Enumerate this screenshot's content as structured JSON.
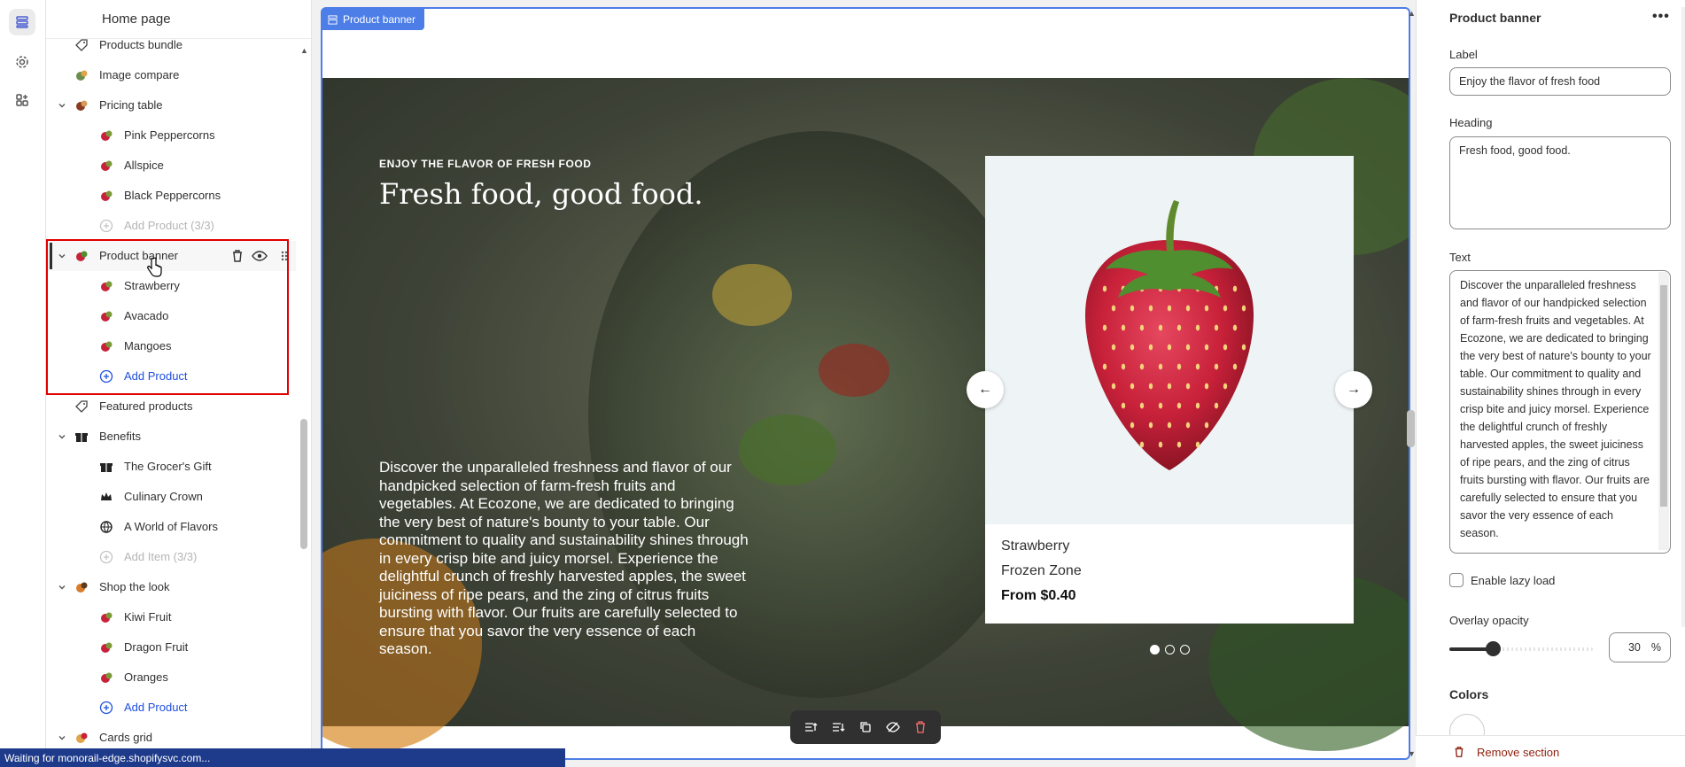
{
  "sidebar": {
    "title": "Home page",
    "rows": [
      {
        "label": "Products bundle",
        "level": 1,
        "icon": "tag-icon",
        "state": ""
      },
      {
        "label": "Image compare",
        "level": 1,
        "icon": "image-compare-icon",
        "state": ""
      },
      {
        "label": "Pricing table",
        "level": 1,
        "icon": "pricing-table-icon",
        "state": "expanded"
      },
      {
        "label": "Pink Peppercorns",
        "level": 2,
        "icon": "product-thumb-icon",
        "state": ""
      },
      {
        "label": "Allspice",
        "level": 2,
        "icon": "product-thumb-icon",
        "state": ""
      },
      {
        "label": "Black Peppercorns",
        "level": 2,
        "icon": "product-thumb-icon",
        "state": ""
      },
      {
        "label": "Add Product (3/3)",
        "level": 2,
        "icon": "add-circle-icon",
        "state": "muted"
      },
      {
        "label": "Product banner",
        "level": 1,
        "icon": "product-banner-icon",
        "state": "selected"
      },
      {
        "label": "Strawberry",
        "level": 2,
        "icon": "product-thumb-icon",
        "state": ""
      },
      {
        "label": "Avacado",
        "level": 2,
        "icon": "product-thumb-icon",
        "state": ""
      },
      {
        "label": "Mangoes",
        "level": 2,
        "icon": "product-thumb-icon",
        "state": ""
      },
      {
        "label": "Add Product",
        "level": 2,
        "icon": "add-circle-icon",
        "state": "add"
      },
      {
        "label": "Featured products",
        "level": 1,
        "icon": "tag-icon",
        "state": ""
      },
      {
        "label": "Benefits",
        "level": 1,
        "icon": "gift-icon",
        "state": "expanded"
      },
      {
        "label": "The Grocer's Gift",
        "level": 2,
        "icon": "gift-icon",
        "state": ""
      },
      {
        "label": "Culinary Crown",
        "level": 2,
        "icon": "crown-icon",
        "state": ""
      },
      {
        "label": "A World of Flavors",
        "level": 2,
        "icon": "globe-icon",
        "state": ""
      },
      {
        "label": "Add Item (3/3)",
        "level": 2,
        "icon": "add-circle-icon",
        "state": "muted"
      },
      {
        "label": "Shop the look",
        "level": 1,
        "icon": "shop-look-icon",
        "state": "expanded"
      },
      {
        "label": "Kiwi Fruit",
        "level": 2,
        "icon": "product-thumb-icon",
        "state": ""
      },
      {
        "label": "Dragon Fruit",
        "level": 2,
        "icon": "product-thumb-icon",
        "state": ""
      },
      {
        "label": "Oranges",
        "level": 2,
        "icon": "product-thumb-icon",
        "state": ""
      },
      {
        "label": "Add Product",
        "level": 2,
        "icon": "add-circle-icon",
        "state": "add"
      },
      {
        "label": "Cards grid",
        "level": 1,
        "icon": "cards-grid-icon",
        "state": "expanded"
      }
    ]
  },
  "preview": {
    "tag": "Product banner",
    "eyebrow": "ENJOY THE FLAVOR OF FRESH FOOD",
    "heading": "Fresh food, good food.",
    "body": "Discover the unparalleled freshness and flavor of our handpicked selection of farm-fresh fruits and vegetables. At Ecozone, we are dedicated to bringing the very best of nature's bounty to your table. Our commitment to quality and sustainability shines through in every crisp bite and juicy morsel. Experience the delightful crunch of freshly harvested apples, the sweet juiciness of ripe pears, and the zing of citrus fruits bursting with flavor. Our fruits are carefully selected to ensure that you savor the very essence of each season.",
    "card": {
      "name": "Strawberry",
      "vendor": "Frozen Zone",
      "price": "From $0.40"
    },
    "prev_arrow": "←",
    "next_arrow": "→",
    "slide_count": 3,
    "active_slide": 1
  },
  "panel": {
    "title": "Product banner",
    "more": "•••",
    "label_label": "Label",
    "label_value": "Enjoy the flavor of fresh food",
    "heading_label": "Heading",
    "heading_value": "Fresh food, good food.",
    "text_label": "Text",
    "text_value": "Discover the unparalleled freshness and flavor of our handpicked selection of farm-fresh fruits and vegetables. At Ecozone, we are dedicated to bringing the very best of nature's bounty to your table. Our commitment to quality and sustainability shines through in every crisp bite and juicy morsel. Experience the delightful crunch of freshly harvested apples, the sweet juiciness of ripe pears, and the zing of citrus fruits bursting with flavor. Our fruits are carefully selected to ensure that you savor the very essence of each season.",
    "lazy_label": "Enable lazy load",
    "lazy_checked": false,
    "opacity_label": "Overlay opacity",
    "opacity_value": "30",
    "opacity_unit": "%",
    "opacity_fraction": 0.3,
    "colors_label": "Colors",
    "remove_label": "Remove section"
  },
  "status": "Waiting for monorail-edge.shopifysvc.com...",
  "colors": {
    "accent": "#4d7ee8",
    "selection": "#e00000",
    "link": "#1f4fe0",
    "danger": "#8e1f0b",
    "status_bar": "#1e3a8a"
  }
}
